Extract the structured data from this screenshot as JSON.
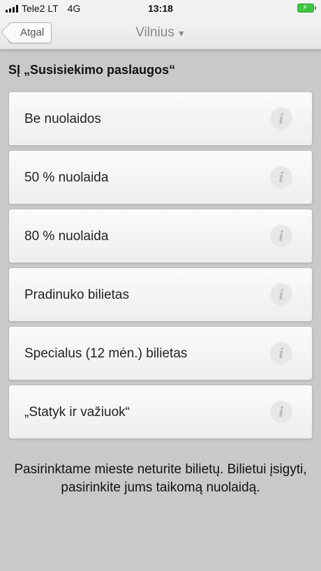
{
  "status_bar": {
    "carrier": "Tele2 LT",
    "network": "4G",
    "time": "13:18"
  },
  "nav": {
    "back_label": "Atgal",
    "title": "Vilnius",
    "title_caret": "▼"
  },
  "section": {
    "title": "SĮ „Susisiekimo paslaugos“"
  },
  "options": [
    {
      "label": "Be nuolaidos"
    },
    {
      "label": "50 % nuolaida"
    },
    {
      "label": "80 % nuolaida"
    },
    {
      "label": "Pradinuko bilietas"
    },
    {
      "label": "Specialus (12 mėn.) bilietas"
    },
    {
      "label": "„Statyk ir važiuok“"
    }
  ],
  "info_icon_glyph": "i",
  "footer": {
    "message": "Pasirinktame mieste neturite bilietų. Bilietui įsigyti, pasirinkite jums taikomą nuolaidą."
  }
}
